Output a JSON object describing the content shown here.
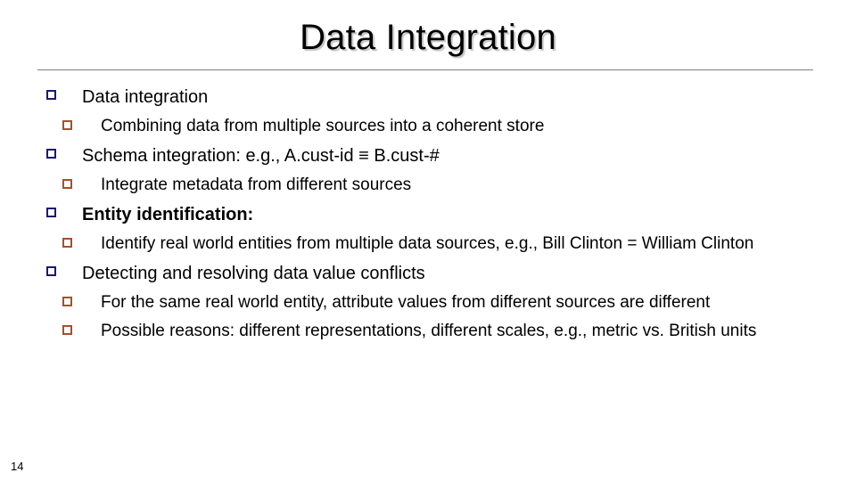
{
  "slide": {
    "title": "Data Integration",
    "page_number": "14",
    "accent_colors": {
      "level1_bullet": "#1a1a6e",
      "level2_bullet": "#a0522d",
      "divider": "#808080",
      "title_shadow": "#969696",
      "background": "#ffffff",
      "text": "#000000"
    },
    "bullets": [
      {
        "level": 1,
        "text": "Data integration",
        "bold": false
      },
      {
        "level": 2,
        "text": "Combining data from multiple sources into a coherent store",
        "bold": false
      },
      {
        "level": 1,
        "text": "Schema integration: e.g., A.cust-id ≡ B.cust-#",
        "bold": false
      },
      {
        "level": 2,
        "text": "Integrate metadata from different sources",
        "bold": false
      },
      {
        "level": 1,
        "text": "Entity identification:",
        "bold": true
      },
      {
        "level": 2,
        "text": "Identify real world entities from multiple data sources, e.g., Bill Clinton = William Clinton",
        "bold": false
      },
      {
        "level": 1,
        "text": "Detecting and resolving data value conflicts",
        "bold": false
      },
      {
        "level": 2,
        "text": "For the same real world entity, attribute values from different sources are different",
        "bold": false
      },
      {
        "level": 2,
        "text": "Possible reasons: different representations, different scales, e.g., metric vs. British units",
        "bold": false
      }
    ]
  }
}
